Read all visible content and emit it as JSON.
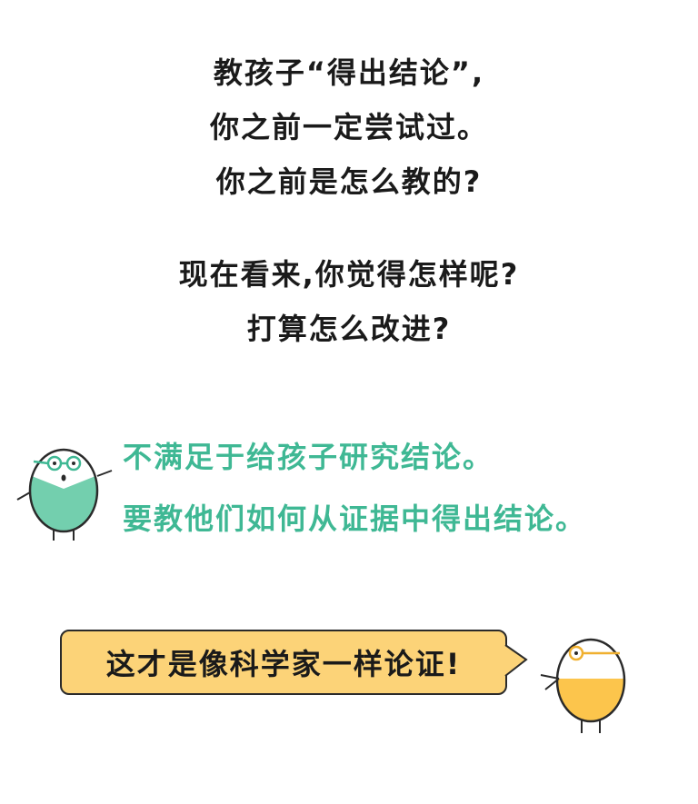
{
  "questions": {
    "block1": [
      "教孩子“得出结论”,",
      "你之前一定尝试过。",
      "你之前是怎么教的?"
    ],
    "block2": [
      "现在看来,你觉得怎样呢?",
      "打算怎么改进?"
    ]
  },
  "green_statement": {
    "line1": "不满足于给孩子研究结论。",
    "line2": "要教他们如何从证据中得出结论。"
  },
  "speech_bubble": {
    "text": "这才是像科学家一样论证!"
  },
  "colors": {
    "green_accent": "#3fb894",
    "bubble_yellow": "#fcd378",
    "egg_yellow": "#fcc54c",
    "egg_green": "#73cfae"
  }
}
